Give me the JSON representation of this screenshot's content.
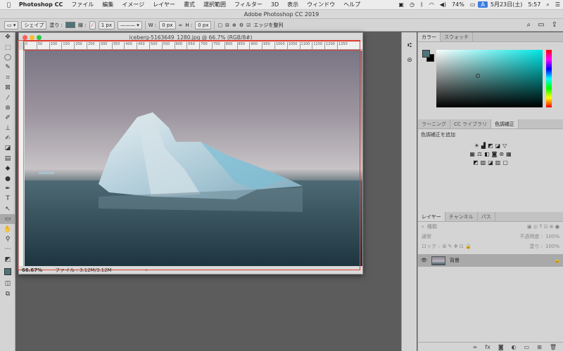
{
  "menubar": {
    "apple": "",
    "app": "Photoshop CC",
    "items": [
      "ファイル",
      "編集",
      "イメージ",
      "レイヤー",
      "書式",
      "選択範囲",
      "フィルター",
      "3D",
      "表示",
      "ウィンドウ",
      "ヘルプ"
    ],
    "battery": "74%",
    "input": "A",
    "date": "5月23日(土)",
    "time": "5:57"
  },
  "window_title": "Adobe Photoshop CC 2019",
  "options": {
    "shape": "シェイプ",
    "fill": "塗り :",
    "stroke": "線 :",
    "width_px": "1 px",
    "w_label": "W :",
    "w_value": "0 px",
    "h_label": "H :",
    "h_value": "0 px",
    "align_edges": "エッジを整列"
  },
  "document": {
    "title": "iceberg-5163649_1280.jpg @ 66.7% (RGB/8#)",
    "zoom": "66.67%",
    "file_info": "ファイル : 3.12M/3.12M",
    "ruler_ticks": [
      "0",
      "50",
      "100",
      "150",
      "200",
      "250",
      "300",
      "350",
      "400",
      "450",
      "500",
      "550",
      "600",
      "650",
      "700",
      "750",
      "800",
      "850",
      "900",
      "950",
      "1000",
      "1050",
      "1100",
      "1150",
      "1200",
      "1250"
    ]
  },
  "panels": {
    "color_tabs": [
      "カラー",
      "スウォッチ"
    ],
    "learn_tabs": [
      "ラーニング",
      "CC ライブラリ",
      "色調補正"
    ],
    "adjust_label": "色調補正を追加",
    "layer_tabs": [
      "レイヤー",
      "チャンネル",
      "パス"
    ],
    "kind": "種類",
    "mode": "通常",
    "opacity_label": "不透明度 :",
    "opacity": "100%",
    "lock": "ロック :",
    "fill_label": "塗り :",
    "fill": "100%",
    "layer_name": "背景"
  },
  "colors": {
    "fg": "#4e7479",
    "accent": "#e04030"
  }
}
